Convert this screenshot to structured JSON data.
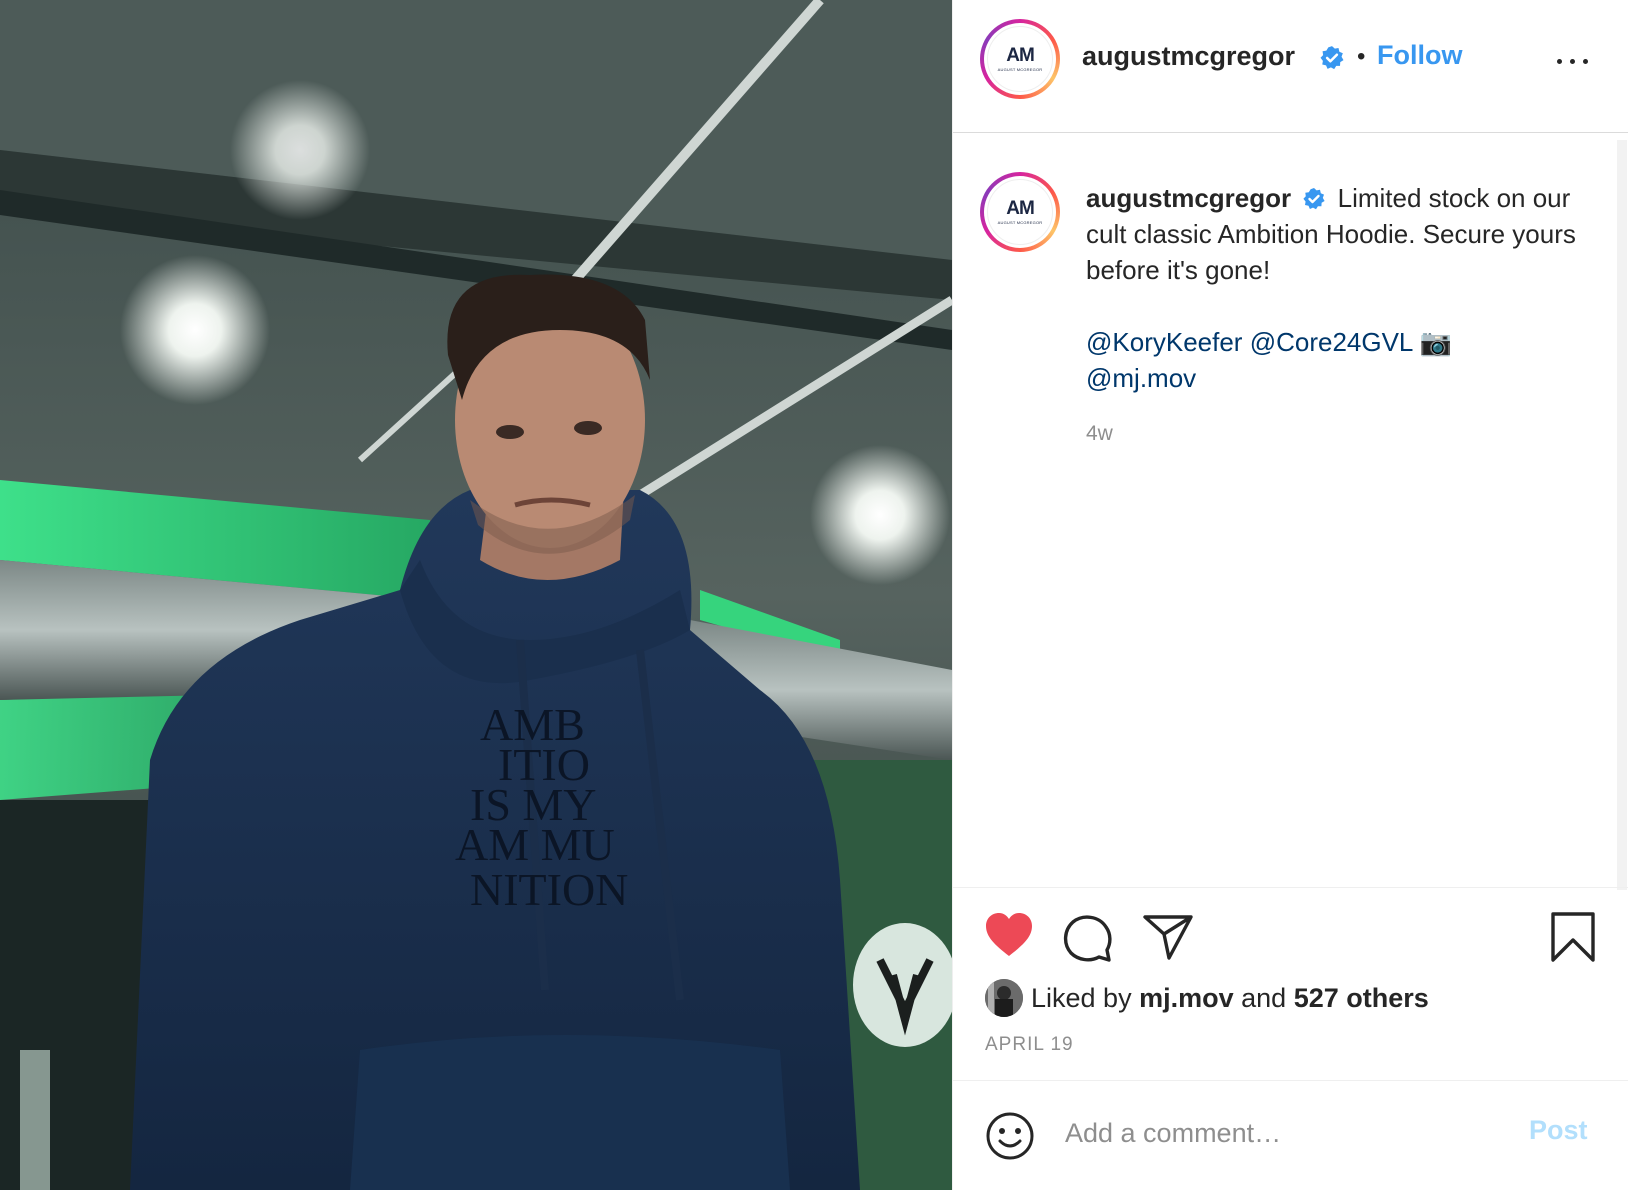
{
  "post": {
    "image_alt": "Man in navy hoodie reading AMBITION IS MY AMMUNITION in a green-lit parking garage",
    "hoodie_print": "AMBITION IS MY AMMUNITION",
    "avatar": {
      "logo_text": "AM",
      "logo_subtext": "AUGUST MCGREGOR"
    }
  },
  "header": {
    "username": "augustmcgregor",
    "separator": "•",
    "follow_label": "Follow"
  },
  "caption": {
    "username": "augustmcgregor",
    "text_line1": "Limited stock on our cult classic Ambition Hoodie. Secure yours before it's gone!",
    "mention1": "@KoryKeefer",
    "mention2": "@Core24GVL",
    "camera_emoji": "📷",
    "mention3": "@mj.mov",
    "time_ago": "4w"
  },
  "engagement": {
    "liked_prefix": "Liked by",
    "liked_user": "mj.mov",
    "liked_and": "and",
    "liked_others": "527 others",
    "date": "APRIL 19"
  },
  "comment": {
    "placeholder": "Add a comment…",
    "post_label": "Post"
  },
  "colors": {
    "accent_blue": "#3897f0",
    "like_red": "#ed4956",
    "mention_blue": "#00376b",
    "post_disabled": "#b2dffc"
  },
  "icons": [
    "verified-badge-icon",
    "more-options-icon",
    "heart-icon",
    "comment-icon",
    "share-icon",
    "bookmark-icon",
    "emoji-icon",
    "camera-icon"
  ]
}
